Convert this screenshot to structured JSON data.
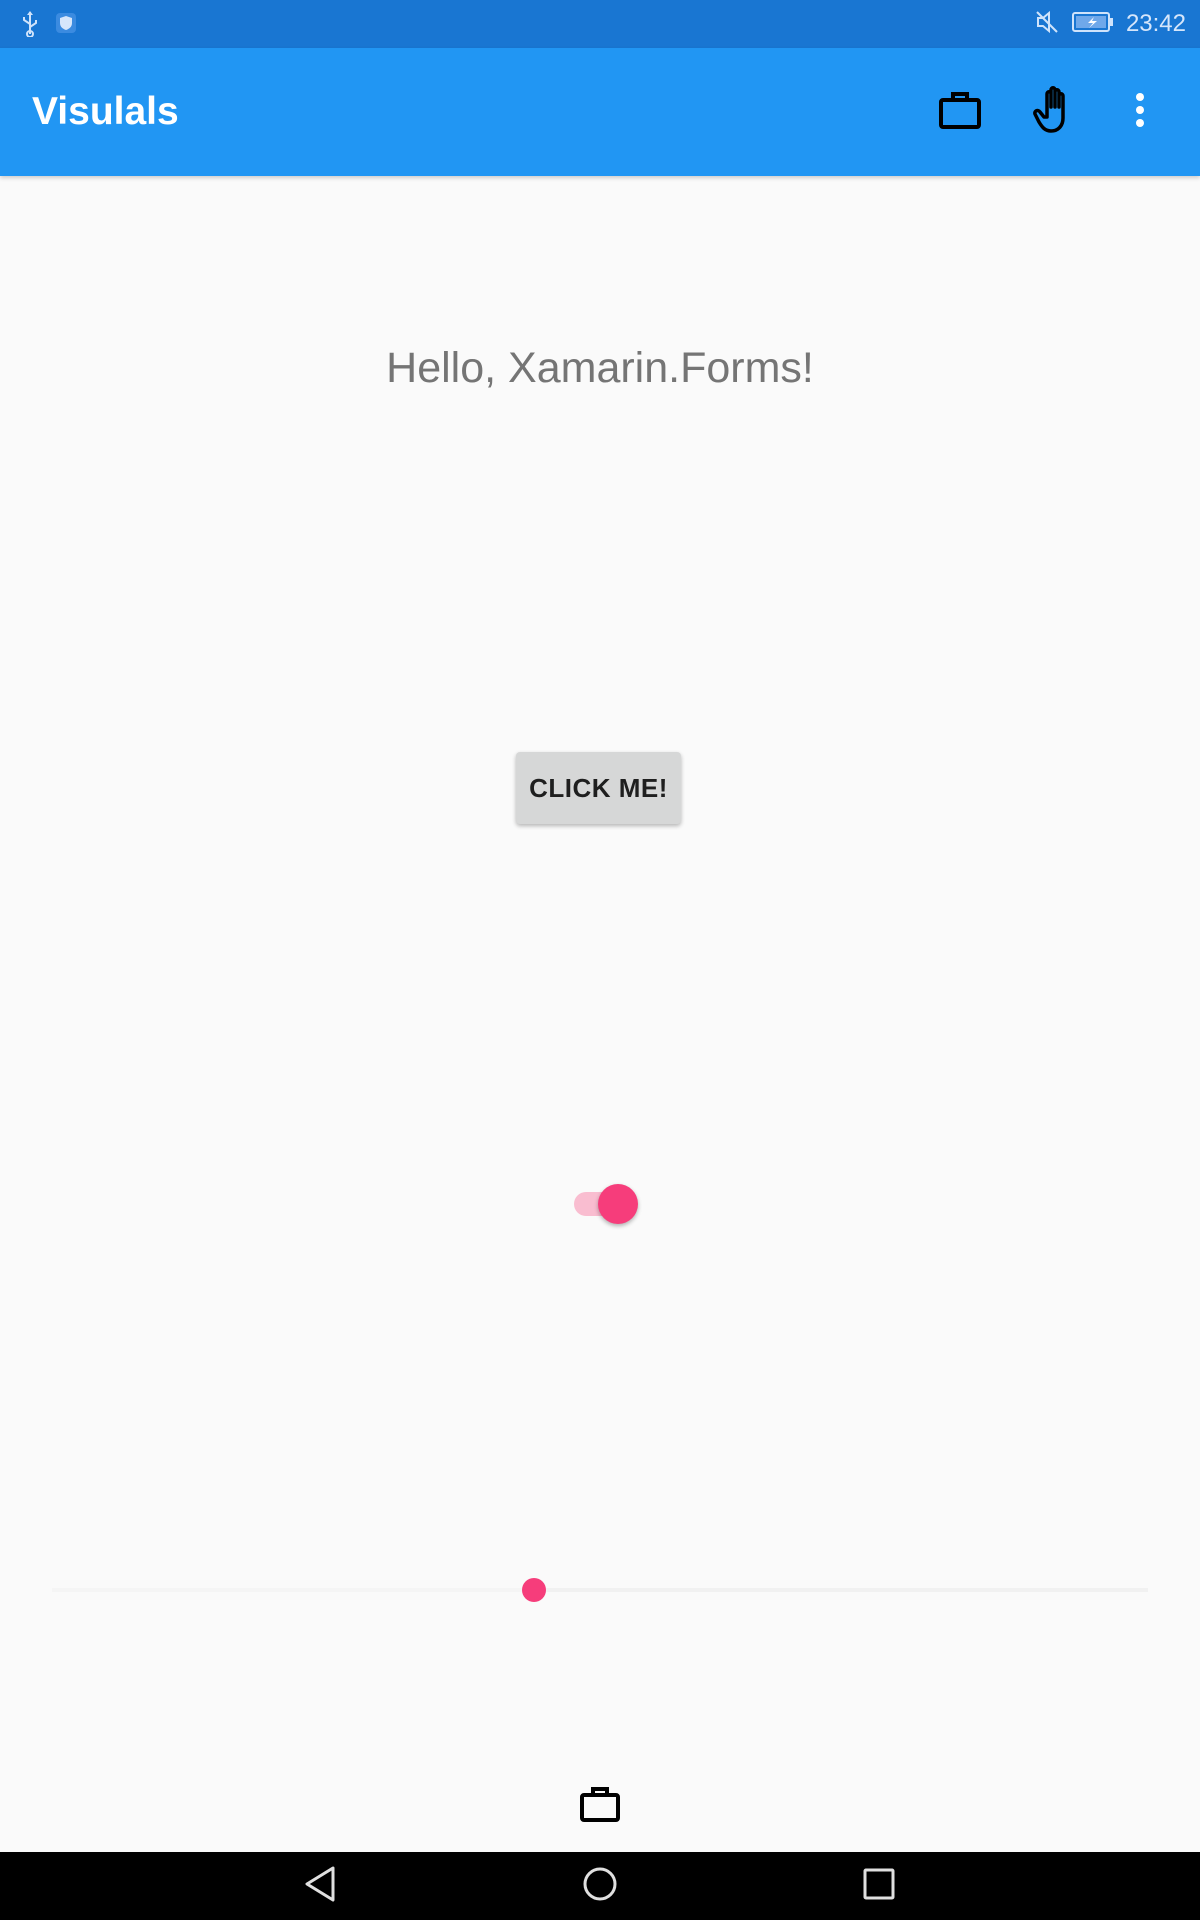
{
  "status_bar": {
    "time": "23:42",
    "left_icons": [
      "usb-icon",
      "shield-icon"
    ],
    "right_icons": [
      "mute-icon",
      "battery-charging-icon"
    ],
    "color": "#1976d2"
  },
  "app_bar": {
    "title": "Visulals",
    "color": "#2196f3",
    "actions": [
      "briefcase-icon",
      "hand-icon",
      "overflow-menu-icon"
    ]
  },
  "main": {
    "label": "Hello, Xamarin.Forms!",
    "button_label": "CLICK ME!",
    "switch_on": true,
    "slider_value": 0.44,
    "accent_color": "#f63d7b"
  },
  "bottom": {
    "icon": "briefcase-icon"
  },
  "nav_bar": {
    "buttons": [
      "back-icon",
      "home-icon",
      "recents-icon"
    ]
  }
}
